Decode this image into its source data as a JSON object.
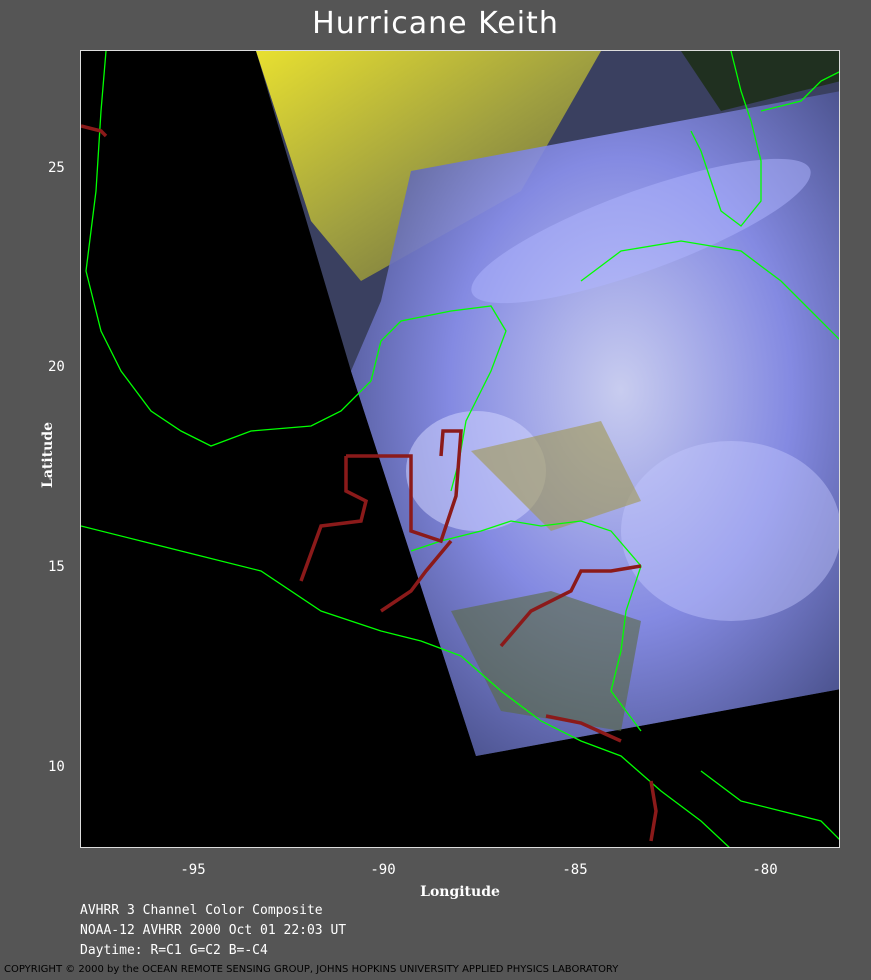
{
  "title": "Hurricane Keith",
  "axes": {
    "xlabel": "Longitude",
    "ylabel": "Latitude",
    "x_ticks": [
      "-95",
      "-90",
      "-85",
      "-80"
    ],
    "y_ticks": [
      "25",
      "20",
      "15",
      "10"
    ]
  },
  "info": {
    "line1": "AVHRR 3 Channel Color Composite",
    "line2": "NOAA-12 AVHRR 2000 Oct 01 22:03 UT",
    "line3": "Daytime: R=C1 G=C2 B=-C4"
  },
  "copyright": "COPYRIGHT © 2000 by the OCEAN REMOTE SENSING GROUP, JOHNS HOPKINS UNIVERSITY APPLIED PHYSICS LABORATORY",
  "colors": {
    "background": "#555555",
    "coastline": "#00ff00",
    "border": "#8b1a1a",
    "cloud": "#8a90ff",
    "land_yellow": "#c8c040"
  }
}
